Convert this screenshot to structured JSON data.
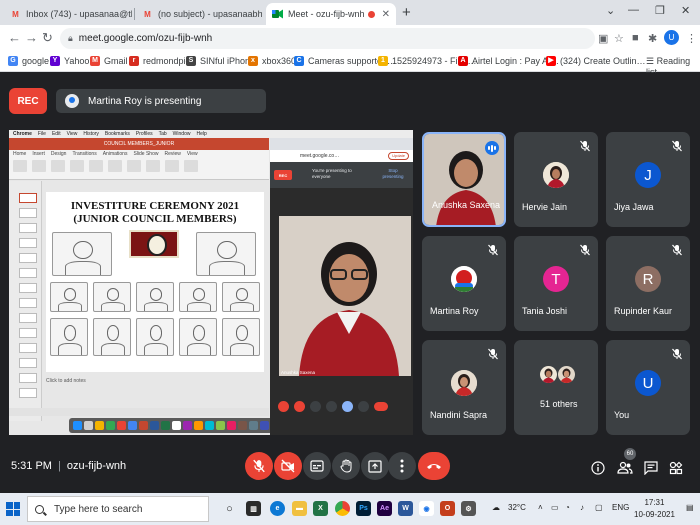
{
  "browser": {
    "tabs": [
      {
        "title": "Inbox (743) - upasanaa@theindi…",
        "icon": "gmail-icon"
      },
      {
        "title": "(no subject) - upasanaabhalla13@…",
        "icon": "gmail-icon"
      },
      {
        "title": "Meet - ozu-fijb-wnh",
        "icon": "meet-icon",
        "active": true
      }
    ],
    "url": "meet.google.com/ozu-fijb-wnh",
    "profile_initial": "U",
    "bookmarks": [
      {
        "label": "google",
        "color": "#4285f4",
        "glyph": "G"
      },
      {
        "label": "Yahoo",
        "color": "#6001d2",
        "glyph": "Y"
      },
      {
        "label": "Gmail",
        "color": "#ea4335",
        "glyph": "M"
      },
      {
        "label": "redmondpie",
        "color": "#d62d20",
        "glyph": "r"
      },
      {
        "label": "SINful iPhone",
        "color": "#444444",
        "glyph": "S"
      },
      {
        "label": "xbox360",
        "color": "#e37400",
        "glyph": "x"
      },
      {
        "label": "Cameras supported…",
        "color": "#1a73e8",
        "glyph": "C"
      },
      {
        "label": "1525924973 - Find…",
        "color": "#f4b400",
        "glyph": "1"
      },
      {
        "label": "Airtel Login : Pay Ai…",
        "color": "#e40000",
        "glyph": "A"
      },
      {
        "label": "(324) Create Outlin…",
        "color": "#ff0000",
        "glyph": "▶"
      }
    ],
    "reading_list": "Reading list"
  },
  "meet": {
    "rec_label": "REC",
    "presenting_label": "Martina Roy is presenting",
    "shared_screen": {
      "slide_title_line1": "INVESTITURE CEREMONY 2021",
      "slide_title_line2": "(JUNIOR COUNCIL MEMBERS)",
      "notes_placeholder": "Click to add notes",
      "popup_rec": "REC",
      "popup_message": "You're presenting to everyone",
      "popup_stop": "Stop presenting",
      "popup_update": "Update",
      "popup_url": "meet.google.co…",
      "popup_speaker": "Anushka Saxena",
      "ppt_menu": [
        "Chrome",
        "File",
        "Edit",
        "View",
        "History",
        "Bookmarks",
        "Profiles",
        "Tab",
        "Window",
        "Help"
      ],
      "ppt_doc_title": "COUNCIL MEMBERS_JUNIOR",
      "ppt_tabs": [
        "Home",
        "Insert",
        "Design",
        "Transitions",
        "Animations",
        "Slide Show",
        "Review",
        "View"
      ]
    },
    "participants": [
      {
        "name": "Anushka Saxena",
        "kind": "video",
        "speaking": true
      },
      {
        "name": "Hervie Jain",
        "kind": "photo",
        "muted": true
      },
      {
        "name": "Jiya Jawa",
        "kind": "letter",
        "initial": "J",
        "color": "#0b57d0",
        "muted": true
      },
      {
        "name": "Martina Roy",
        "kind": "photo-apple",
        "muted": true
      },
      {
        "name": "Tania Joshi",
        "kind": "letter",
        "initial": "T",
        "color": "#e52592",
        "muted": true
      },
      {
        "name": "Rupinder Kaur",
        "kind": "letter",
        "initial": "R",
        "color": "#8d6e63",
        "muted": true
      },
      {
        "name": "Nandini Sapra",
        "kind": "photo",
        "muted": true
      },
      {
        "name": "51 others",
        "kind": "group",
        "muted": false
      },
      {
        "name": "You",
        "kind": "letter",
        "initial": "U",
        "color": "#0b57d0",
        "muted": true
      }
    ],
    "bottom": {
      "time": "5:31 PM",
      "meeting_code": "ozu-fijb-wnh",
      "participant_count": "60"
    }
  },
  "taskbar": {
    "search_placeholder": "Type here to search",
    "temperature": "32°C",
    "language": "ENG",
    "clock_time": "17:31",
    "clock_date": "10-09-2021"
  }
}
